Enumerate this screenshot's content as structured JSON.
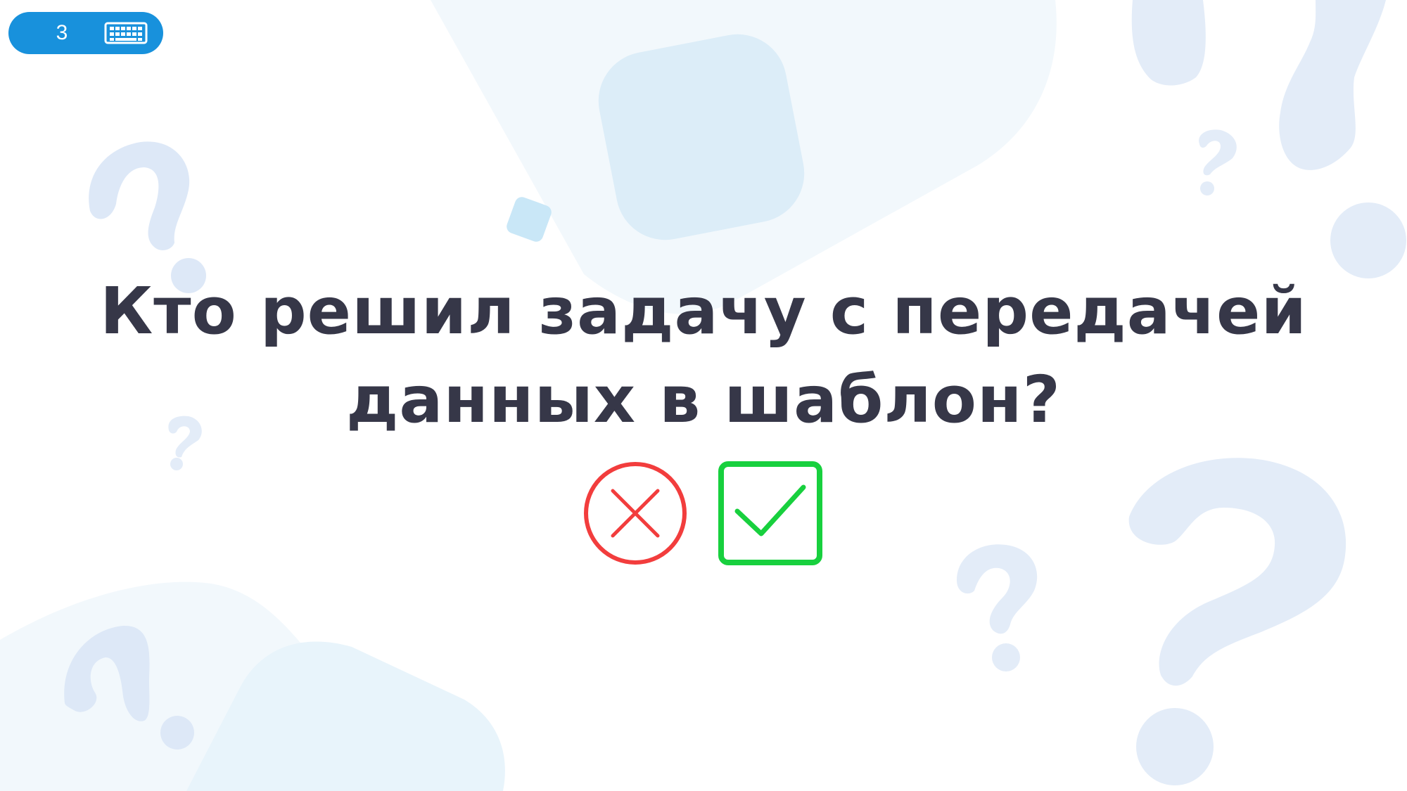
{
  "slide": {
    "number": "3",
    "keyboard_icon": "keyboard-icon"
  },
  "question": {
    "text": "Кто решил задачу с передачей данных в шаблон?"
  },
  "answers": {
    "wrong_icon": "cross-circle-icon",
    "right_icon": "check-square-icon"
  },
  "colors": {
    "accent": "#1891dc",
    "text": "#363748",
    "wrong": "#f23d3d",
    "right": "#18d03e",
    "decor_light": "#e3ecf8"
  }
}
